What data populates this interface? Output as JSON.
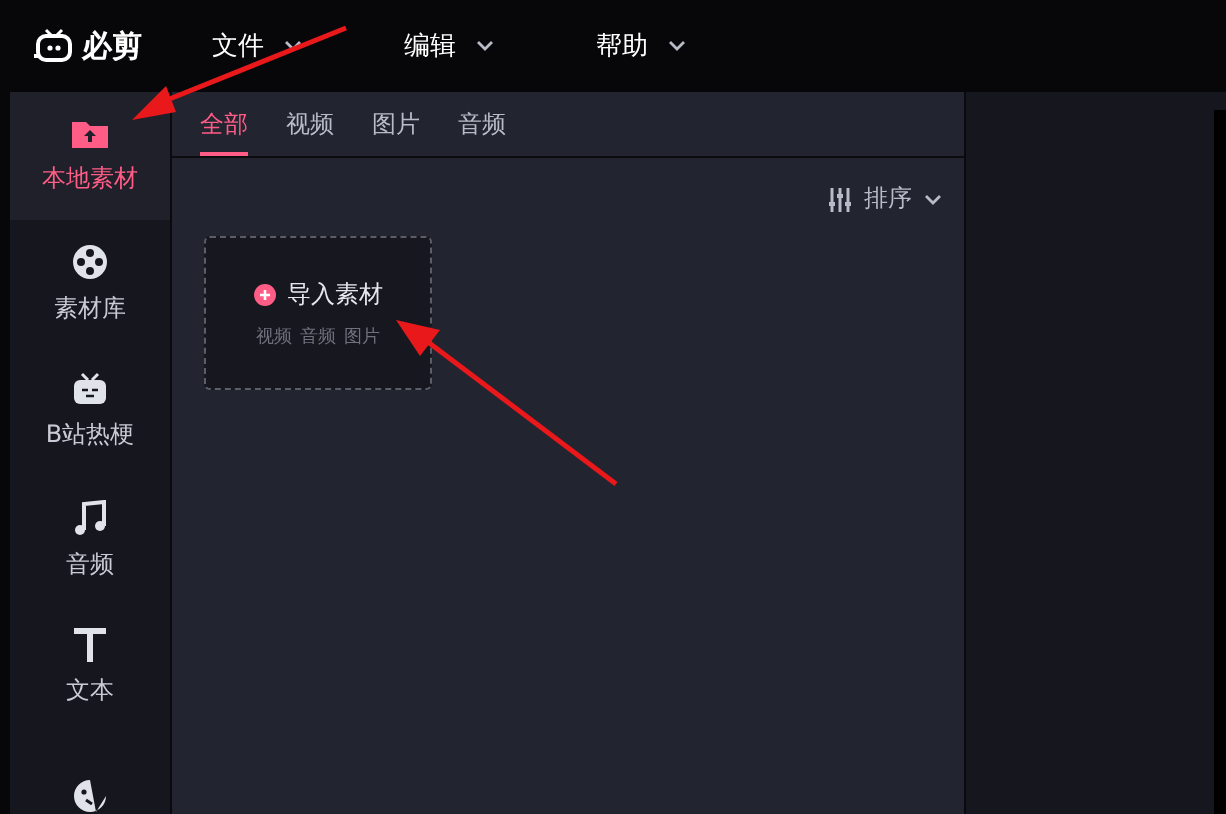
{
  "app": {
    "logo_text": "必剪"
  },
  "menu": [
    {
      "label": "文件"
    },
    {
      "label": "编辑"
    },
    {
      "label": "帮助"
    }
  ],
  "sidebar": {
    "items": [
      {
        "kind": "local",
        "label": "本地素材",
        "selected": true
      },
      {
        "kind": "library",
        "label": "素材库",
        "selected": false
      },
      {
        "kind": "bili",
        "label": "B站热梗",
        "selected": false
      },
      {
        "kind": "audio",
        "label": "音频",
        "selected": false
      },
      {
        "kind": "text",
        "label": "文本",
        "selected": false
      },
      {
        "kind": "sticker",
        "selected": false
      }
    ]
  },
  "tabs": [
    {
      "label": "全部",
      "selected": true
    },
    {
      "label": "视频",
      "selected": false
    },
    {
      "label": "图片",
      "selected": false
    },
    {
      "label": "音频",
      "selected": false
    }
  ],
  "sort": {
    "label": "排序"
  },
  "import_card": {
    "title": "导入素材",
    "types": [
      "视频",
      "音频",
      "图片"
    ]
  }
}
